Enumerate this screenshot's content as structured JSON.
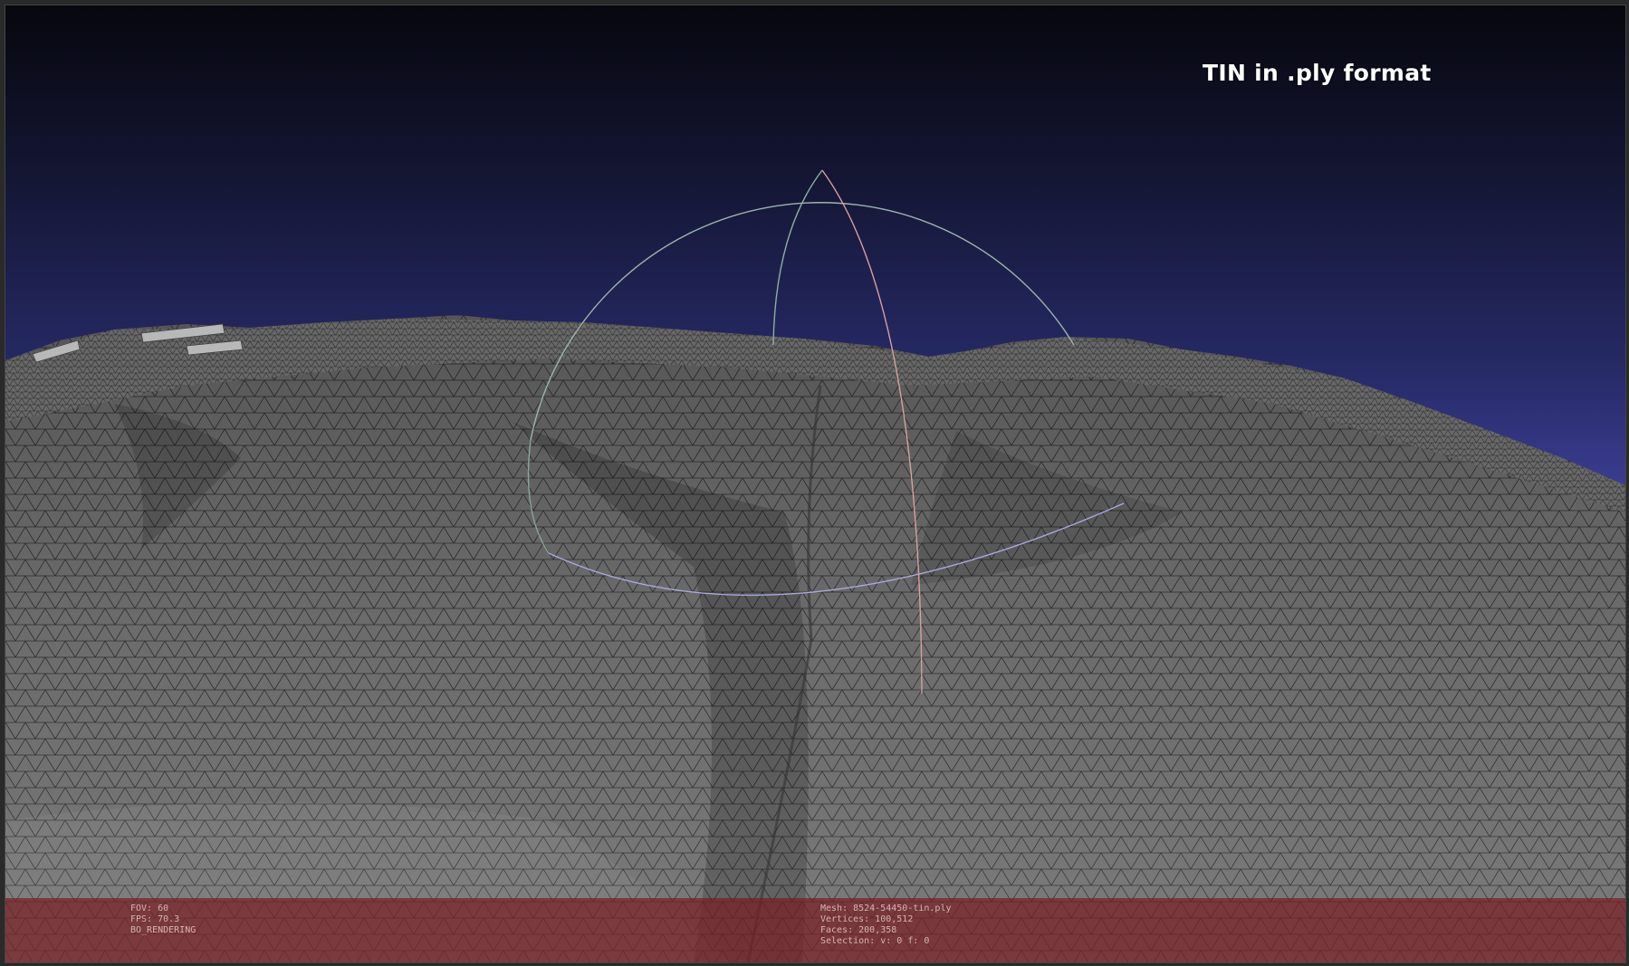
{
  "overlay": {
    "title": "TIN in .ply format"
  },
  "info_left": {
    "fov": "FOV: 60",
    "fps": "FPS:   70.3",
    "rendering": "BO_RENDERING"
  },
  "info_right": {
    "mesh": "Mesh: 8524-54450-tin.ply",
    "vertices": "Vertices: 100,512",
    "faces": "Faces: 200,358",
    "selection": "Selection: v: 0 f: 0"
  },
  "colors": {
    "sky_top": "#07070e",
    "sky_bottom": "#5050b0",
    "mesh_fill": "#6e6e6e",
    "mesh_wire": "#2e2e2e",
    "info_bar": "#781e22",
    "trackball_red": "#d89a9a",
    "trackball_green": "#8fb0a0",
    "trackball_blue": "#9a9ad8"
  },
  "icons": [
    "trackball-gizmo"
  ]
}
